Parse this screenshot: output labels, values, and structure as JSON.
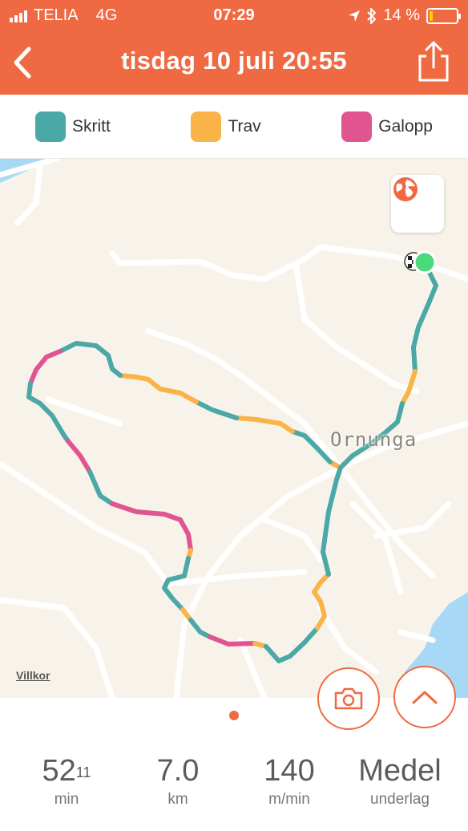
{
  "status_bar": {
    "carrier": "TELIA",
    "network": "4G",
    "time": "07:29",
    "battery": "14 %",
    "battery_level": 0.14
  },
  "header": {
    "title": "tisdag 10 juli 20:55",
    "back_icon": "chevron-left-icon",
    "share_icon": "share-icon"
  },
  "legend": [
    {
      "label": "Skritt",
      "color": "#4aa9a6"
    },
    {
      "label": "Trav",
      "color": "#f9b347"
    },
    {
      "label": "Galopp",
      "color": "#e0558f"
    }
  ],
  "map": {
    "place_label": "Ornunga",
    "terms_link": "Villkor",
    "globe_icon": "globe-icon"
  },
  "actions": {
    "camera_icon": "camera-icon",
    "expand_icon": "chevron-up-icon"
  },
  "stats": [
    {
      "value": "52",
      "superscript": "11",
      "unit": "min"
    },
    {
      "value": "7.0",
      "superscript": "",
      "unit": "km"
    },
    {
      "value": "140",
      "superscript": "",
      "unit": "m/min"
    },
    {
      "value": "Medel",
      "superscript": "",
      "unit": "underlag"
    }
  ],
  "colors": {
    "accent": "#ef6a43",
    "walk": "#4aa9a6",
    "trot": "#f9b347",
    "gallop": "#e0558f",
    "start_marker": "#4cd97b"
  }
}
